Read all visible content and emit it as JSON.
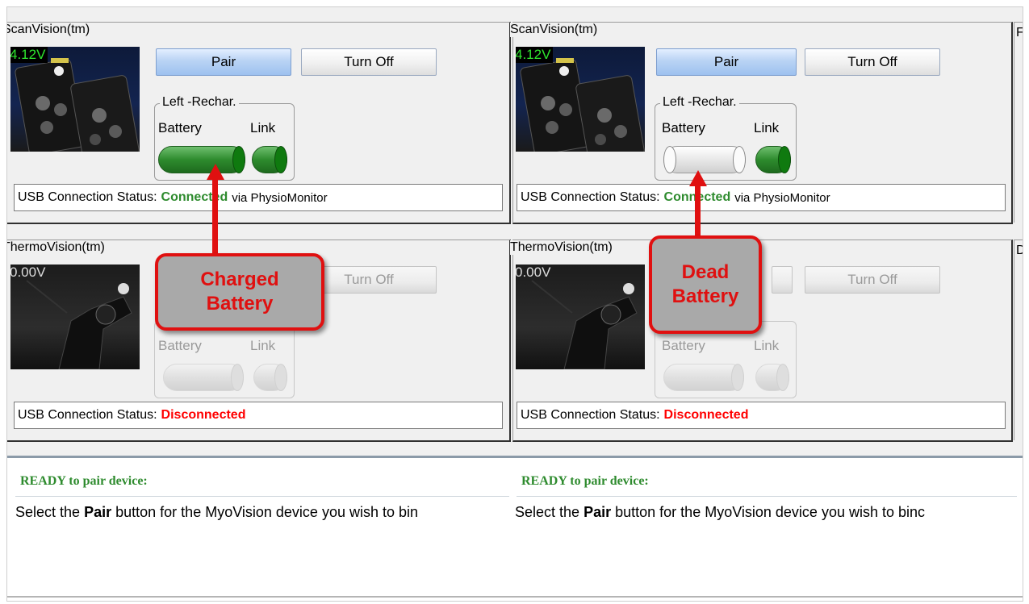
{
  "panels": {
    "scan_left": {
      "title": "ScanVision(tm)",
      "voltage": "4.12V",
      "pair": "Pair",
      "turn_off": "Turn Off",
      "group": "Left -Rechar.",
      "battery": "Battery",
      "link": "Link",
      "battery_level": 1.0,
      "status_label": "USB Connection Status:",
      "status_value": "Connected",
      "status_suffix": "via PhysioMonitor"
    },
    "scan_right": {
      "title": "ScanVision(tm)",
      "voltage": "4.12V",
      "pair": "Pair",
      "turn_off": "Turn Off",
      "group": "Left -Rechar.",
      "battery": "Battery",
      "link": "Link",
      "battery_level": 0.0,
      "status_label": "USB Connection Status:",
      "status_value": "Connected",
      "status_suffix": "via PhysioMonitor"
    },
    "thermo_left": {
      "title": "ThermoVision(tm)",
      "voltage": "0.00V",
      "turn_off": "Turn Off",
      "battery": "Battery",
      "link": "Link",
      "status_label": "USB Connection Status:",
      "status_value": "Disconnected"
    },
    "thermo_right": {
      "title": "ThermoVision(tm)",
      "voltage": "0.00V",
      "turn_off": "Turn Off",
      "battery": "Battery",
      "link": "Link",
      "status_label": "USB Connection Status:",
      "status_value": "Disconnected"
    }
  },
  "callouts": {
    "charged": "Charged Battery",
    "dead": "Dead Battery"
  },
  "ready": {
    "left_title": "READY to pair device:",
    "right_title": "READY to pair device:",
    "instr_pre": "Select the",
    "instr_bold": "Pair",
    "instr_post": "button for the MyoVision device you wish to bin",
    "instr_post_right": "button for the MyoVision device you wish to binc"
  },
  "edge_letters": [
    "F",
    "D"
  ],
  "colors": {
    "connected": "#2e8b2e",
    "disconnected": "#ff0000",
    "callout_border": "#e01010",
    "voltage_on": "#2ee52e"
  }
}
